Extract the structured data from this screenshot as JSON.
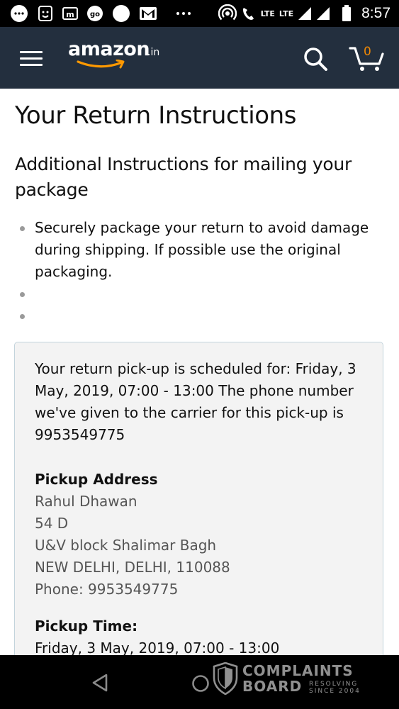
{
  "status_bar": {
    "time": "8:57",
    "network_1": "LTE",
    "network_2": "LTE",
    "icons": [
      "chat-bubble-icon",
      "app-face-icon",
      "m-app-icon",
      "go-app-icon",
      "circle-app-icon",
      "gmail-icon",
      "more-dots-icon",
      "hotspot-icon",
      "wifi-calling-icon",
      "signal-icon",
      "signal-icon",
      "battery-icon"
    ]
  },
  "header": {
    "logo_text": "amazon",
    "logo_suffix": ".in",
    "cart_count": "0",
    "icons": [
      "menu-icon",
      "search-icon",
      "cart-icon"
    ],
    "colors": {
      "header_bg": "#232f3e",
      "cart_count": "#f08804",
      "smile": "#ff9900"
    }
  },
  "main": {
    "title": "Your Return Instructions",
    "section_heading": "Additional Instructions for mailing your package",
    "instructions": [
      "Securely package your return to avoid damage during shipping. If possible use the original packaging.",
      "",
      ""
    ],
    "pickup": {
      "schedule_text": "Your return pick-up is scheduled for: Friday, 3 May, 2019, 07:00 - 13:00 The phone number we've given to the carrier for this pick-up is 9953549775",
      "address_label": "Pickup Address",
      "address_lines": [
        "Rahul Dhawan",
        "54 D",
        "U&V block Shalimar Bagh",
        "NEW DELHI, DELHI, 110088",
        "Phone: 9953549775"
      ],
      "time_label": "Pickup Time:",
      "time_value": "Friday, 3 May, 2019, 07:00 - 13:00"
    }
  },
  "nav_bar": {
    "icons": [
      "back-icon",
      "home-icon"
    ]
  },
  "watermark": {
    "line1": "COMPLAINTS",
    "line2": "BOARD",
    "tag1": "RESOLVING",
    "tag2": "SINCE 2004"
  }
}
